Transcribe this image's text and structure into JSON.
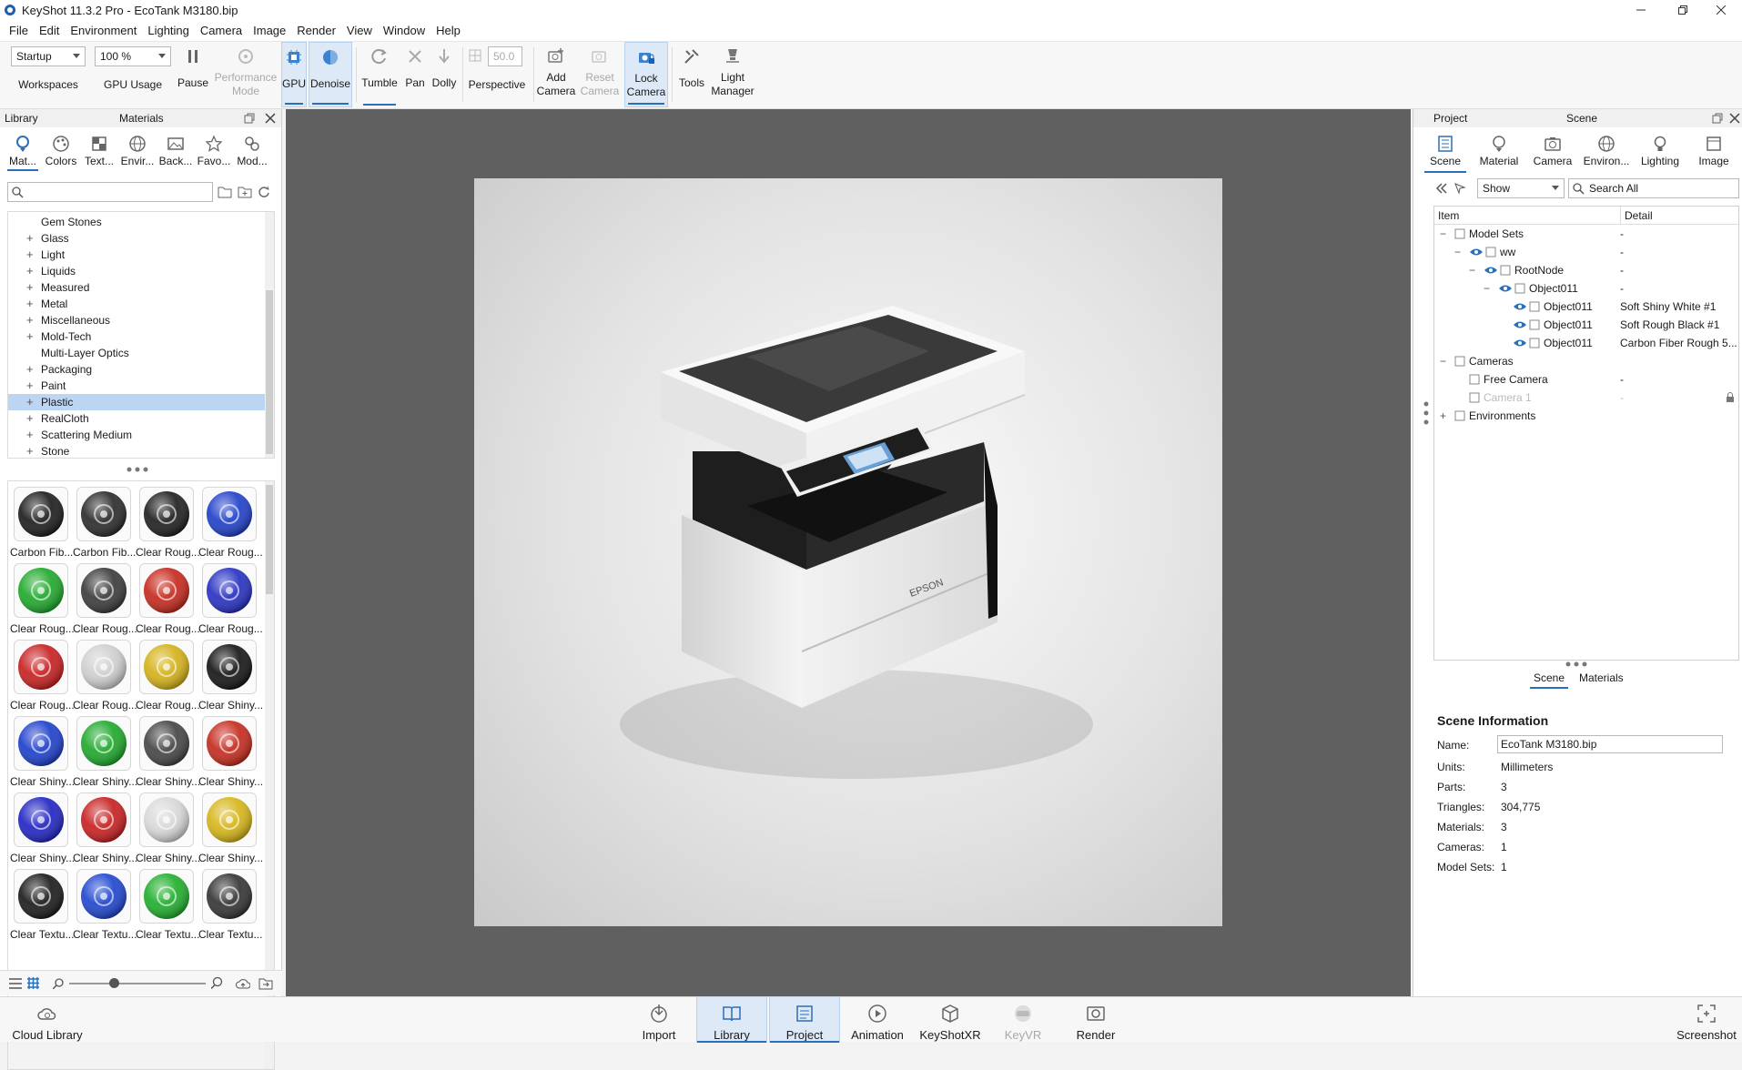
{
  "window": {
    "title": "KeyShot 11.3.2 Pro  - EcoTank M3180.bip"
  },
  "menu": [
    "File",
    "Edit",
    "Environment",
    "Lighting",
    "Camera",
    "Image",
    "Render",
    "View",
    "Window",
    "Help"
  ],
  "toolbar": {
    "workspace_value": "Startup",
    "workspace_label": "Workspaces",
    "gpu_usage_value": "100 %",
    "gpu_usage_label": "GPU Usage",
    "pause": "Pause",
    "performance_mode": [
      "Performance",
      "Mode"
    ],
    "gpu": "GPU",
    "denoise": "Denoise",
    "tumble": "Tumble",
    "pan": "Pan",
    "dolly": "Dolly",
    "fov_value": "50.0",
    "perspective": "Perspective",
    "add_camera": [
      "Add",
      "Camera"
    ],
    "reset_camera": [
      "Reset",
      "Camera"
    ],
    "lock_camera": [
      "Lock",
      "Camera"
    ],
    "tools": "Tools",
    "light_manager": [
      "Light",
      "Manager"
    ]
  },
  "library": {
    "panel_title": "Library",
    "section_title": "Materials",
    "categories": [
      "Mat...",
      "Colors",
      "Text...",
      "Envir...",
      "Back...",
      "Favo...",
      "Mod..."
    ],
    "tree": [
      "Gem Stones",
      "Glass",
      "Light",
      "Liquids",
      "Measured",
      "Metal",
      "Miscellaneous",
      "Mold-Tech",
      "Multi-Layer Optics",
      "Packaging",
      "Paint",
      "Plastic",
      "RealCloth",
      "Scattering Medium",
      "Stone"
    ],
    "selected_tree_item": "Plastic",
    "materials": [
      {
        "name": "Carbon Fib...",
        "color": "#1c1c1c"
      },
      {
        "name": "Carbon Fib...",
        "color": "#2a2a2a"
      },
      {
        "name": "Clear Roug...",
        "color": "#1e1e1e"
      },
      {
        "name": "Clear Roug...",
        "color": "#1f3fc9"
      },
      {
        "name": "Clear Roug...",
        "color": "#1ea82a"
      },
      {
        "name": "Clear Roug...",
        "color": "#3a3a3a"
      },
      {
        "name": "Clear Roug...",
        "color": "#c6281c"
      },
      {
        "name": "Clear Roug...",
        "color": "#2630c2"
      },
      {
        "name": "Clear Roug...",
        "color": "#c81f1f"
      },
      {
        "name": "Clear Roug...",
        "color": "#cfcfcf"
      },
      {
        "name": "Clear Roug...",
        "color": "#d4b117"
      },
      {
        "name": "Clear Shiny...",
        "color": "#141414"
      },
      {
        "name": "Clear Shiny...",
        "color": "#1d3fcc"
      },
      {
        "name": "Clear Shiny...",
        "color": "#1ea82a"
      },
      {
        "name": "Clear Shiny...",
        "color": "#444444"
      },
      {
        "name": "Clear Shiny...",
        "color": "#c52a1d"
      },
      {
        "name": "Clear Shiny...",
        "color": "#2124c4"
      },
      {
        "name": "Clear Shiny...",
        "color": "#c81f1f"
      },
      {
        "name": "Clear Shiny...",
        "color": "#d8d8d8"
      },
      {
        "name": "Clear Shiny...",
        "color": "#d6b517"
      },
      {
        "name": "Clear Textu...",
        "color": "#1a1a1a"
      },
      {
        "name": "Clear Textu...",
        "color": "#1f45cf"
      },
      {
        "name": "Clear Textu...",
        "color": "#1fae2b"
      },
      {
        "name": "Clear Textu...",
        "color": "#333333"
      }
    ]
  },
  "project": {
    "panel_title": "Project",
    "section_title": "Scene",
    "tabs": [
      "Scene",
      "Material",
      "Camera",
      "Environ...",
      "Lighting",
      "Image"
    ],
    "show_value": "Show",
    "search_placeholder": "Search All",
    "columns": [
      "Item",
      "Detail"
    ],
    "tree": [
      {
        "label": "Model Sets",
        "detail": "-",
        "indent": 0,
        "eye": false
      },
      {
        "label": "ww",
        "detail": "-",
        "indent": 1,
        "eye": true
      },
      {
        "label": "RootNode",
        "detail": "-",
        "indent": 2,
        "eye": true
      },
      {
        "label": "Object011",
        "detail": "-",
        "indent": 3,
        "eye": true
      },
      {
        "label": "Object011",
        "detail": "Soft Shiny White #1",
        "indent": 4,
        "eye": true
      },
      {
        "label": "Object011",
        "detail": "Soft Rough Black #1",
        "indent": 4,
        "eye": true
      },
      {
        "label": "Object011",
        "detail": "Carbon Fiber Rough 5...",
        "indent": 4,
        "eye": true
      },
      {
        "label": "Cameras",
        "detail": "",
        "indent": 0,
        "eye": false
      },
      {
        "label": "Free Camera",
        "detail": "-",
        "indent": 1,
        "eye": false
      },
      {
        "label": "Camera 1",
        "detail": "-",
        "indent": 1,
        "eye": false
      },
      {
        "label": "Environments",
        "detail": "",
        "indent": 0,
        "eye": false
      }
    ],
    "subtabs": [
      "Scene",
      "Materials"
    ],
    "info_title": "Scene Information",
    "info": [
      {
        "label": "Name:",
        "value": "EcoTank M3180.bip"
      },
      {
        "label": "Units:",
        "value": "Millimeters"
      },
      {
        "label": "Parts:",
        "value": "3"
      },
      {
        "label": "Triangles:",
        "value": "304,775"
      },
      {
        "label": "Materials:",
        "value": "3"
      },
      {
        "label": "Cameras:",
        "value": "1"
      },
      {
        "label": "Model Sets:",
        "value": "1"
      }
    ]
  },
  "render": {
    "brand_text": "EPSON"
  },
  "bottom": {
    "cloud_library": "Cloud Library",
    "buttons": [
      "Import",
      "Library",
      "Project",
      "Animation",
      "KeyShotXR",
      "KeyVR",
      "Render"
    ],
    "screenshot": "Screenshot"
  },
  "colors": {
    "accent": "#2a6fba",
    "selection": "#bcd5f2",
    "viewport": "#606060"
  }
}
